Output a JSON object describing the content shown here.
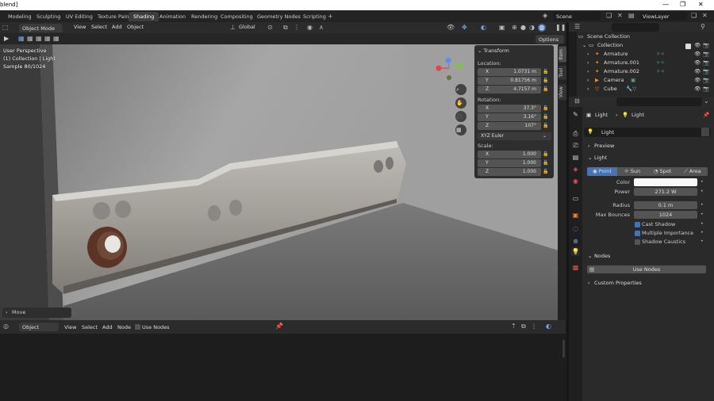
{
  "window": {
    "title": "blend]"
  },
  "workspaces": [
    "Modeling",
    "Sculpting",
    "UV Editing",
    "Texture Paint",
    "Shading",
    "Animation",
    "Rendering",
    "Compositing",
    "Geometry Nodes",
    "Scripting"
  ],
  "active_workspace": "Shading",
  "scene": {
    "label": "Scene",
    "view_layer": "ViewLayer"
  },
  "viewport_header": {
    "mode": "Object Mode",
    "menus": [
      "View",
      "Select",
      "Add",
      "Object"
    ],
    "transform_orientation": "Global",
    "options_label": "Options"
  },
  "viewport": {
    "overlay_lines": [
      "User Perspective",
      "(1) Collection | Light",
      "Sample 80/1024"
    ]
  },
  "npanel": {
    "section": "Transform",
    "location_label": "Location:",
    "location": [
      {
        "axis": "X",
        "value": "1.0731 m"
      },
      {
        "axis": "Y",
        "value": "0.81756 m"
      },
      {
        "axis": "Z",
        "value": "4.7157 m"
      }
    ],
    "rotation_label": "Rotation:",
    "rotation": [
      {
        "axis": "X",
        "value": "37.3°"
      },
      {
        "axis": "Y",
        "value": "3.16°"
      },
      {
        "axis": "Z",
        "value": "107°"
      }
    ],
    "rotation_mode": "XYZ Euler",
    "scale_label": "Scale:",
    "scale": [
      {
        "axis": "X",
        "value": "1.000"
      },
      {
        "axis": "Y",
        "value": "1.000"
      },
      {
        "axis": "Z",
        "value": "1.000"
      }
    ],
    "tabs": [
      "Item",
      "Tool",
      "View"
    ]
  },
  "move_panel": {
    "label": "Move"
  },
  "node_editor": {
    "type": "Object",
    "menus": [
      "View",
      "Select",
      "Add",
      "Node"
    ],
    "use_nodes_label": "Use Nodes"
  },
  "outliner": {
    "root": "Scene Collection",
    "collection": "Collection",
    "items": [
      {
        "name": "Armature",
        "icon_color": "#e88a3e"
      },
      {
        "name": "Armature.001",
        "icon_color": "#e88a3e"
      },
      {
        "name": "Armature.002",
        "icon_color": "#e88a3e"
      },
      {
        "name": "Camera",
        "icon_color": "#4caf80"
      },
      {
        "name": "Cube",
        "icon_color": "#e88a3e"
      }
    ]
  },
  "properties": {
    "breadcrumb": [
      "Light",
      "Light"
    ],
    "datablock": "Light",
    "sections": {
      "preview": "Preview",
      "light": "Light",
      "nodes": "Nodes",
      "custom": "Custom Properties"
    },
    "light_types": [
      "Point",
      "Sun",
      "Spot",
      "Area"
    ],
    "active_light_type": "Point",
    "color_label": "Color",
    "power_label": "Power",
    "power": "271.2 W",
    "radius_label": "Radius",
    "radius": "0.1 m",
    "bounces_label": "Max Bounces",
    "bounces": "1024",
    "cast_shadow": "Cast Shadow",
    "multiple_importance": "Multiple Importance",
    "shadow_caustics": "Shadow Caustics",
    "use_nodes_button": "Use Nodes"
  },
  "colors": {
    "accent": "#4772b3",
    "bg": "#1d1d1d",
    "panel": "#2a2a2a"
  }
}
